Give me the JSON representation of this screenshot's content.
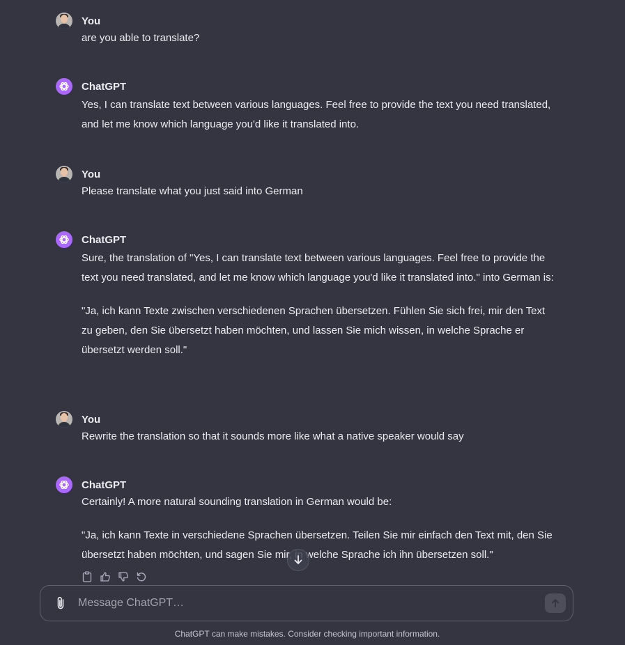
{
  "conversation": {
    "messages": [
      {
        "sender": "You",
        "role": "user",
        "paragraphs": [
          "are you able to translate?"
        ]
      },
      {
        "sender": "ChatGPT",
        "role": "assistant",
        "paragraphs": [
          "Yes, I can translate text between various languages. Feel free to provide the text you need translated, and let me know which language you'd like it translated into."
        ]
      },
      {
        "sender": "You",
        "role": "user",
        "paragraphs": [
          "Please translate what you just said into German"
        ]
      },
      {
        "sender": "ChatGPT",
        "role": "assistant",
        "paragraphs": [
          "Sure, the translation of \"Yes, I can translate text between various languages. Feel free to provide the text you need translated, and let me know which language you'd like it translated into.\" into German is:",
          "\"Ja, ich kann Texte zwischen verschiedenen Sprachen übersetzen. Fühlen Sie sich frei, mir den Text zu geben, den Sie übersetzt haben möchten, und lassen Sie mich wissen, in welche Sprache er übersetzt werden soll.\""
        ]
      },
      {
        "sender": "You",
        "role": "user",
        "paragraphs": [
          "Rewrite the translation so that it sounds more like what a native speaker would say"
        ]
      },
      {
        "sender": "ChatGPT",
        "role": "assistant",
        "paragraphs": [
          "Certainly! A more natural sounding translation in German would be:",
          "\"Ja, ich kann Texte in verschiedene Sprachen übersetzen. Teilen Sie mir einfach den Text mit, den Sie übersetzt haben möchten, und sagen Sie mir, in welche Sprache ich ihn übersetzen soll.\""
        ]
      }
    ],
    "message_actions": [
      "clipboard-icon",
      "thumbs-up-icon",
      "thumbs-down-icon",
      "regenerate-icon"
    ]
  },
  "composer": {
    "placeholder": "Message ChatGPT…",
    "attach_icon": "paperclip-icon",
    "send_icon": "arrow-up-icon"
  },
  "footer": {
    "disclaimer": "ChatGPT can make mistakes. Consider checking important information."
  },
  "colors": {
    "background": "#343541",
    "text": "#ececf1",
    "assistant_avatar": "#ab68ff",
    "muted": "#c5c5d2"
  }
}
